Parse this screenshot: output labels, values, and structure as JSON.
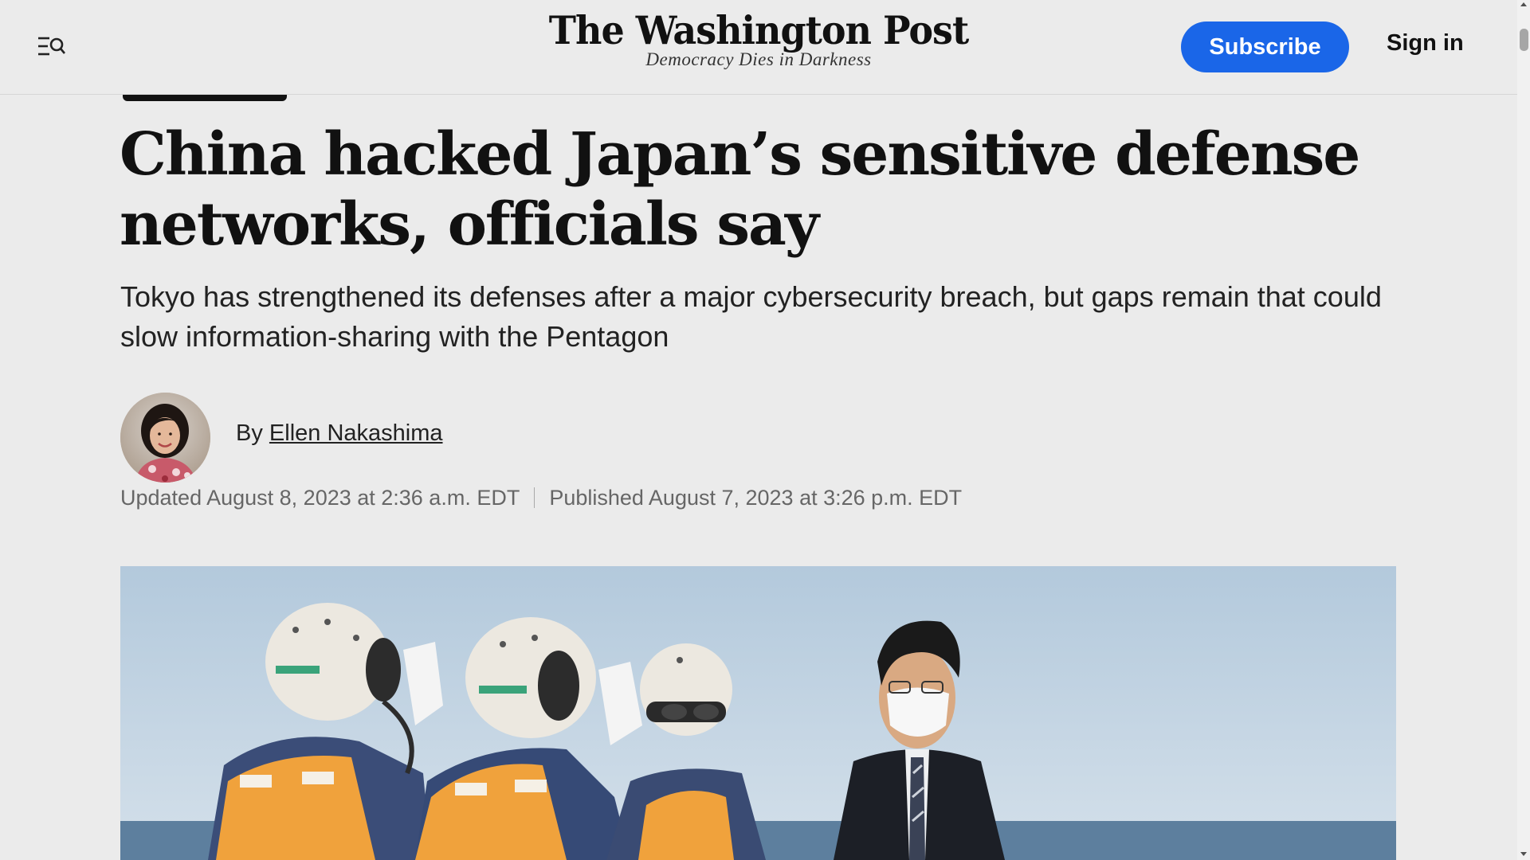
{
  "header": {
    "logo": "The Washington Post",
    "tagline": "Democracy Dies in Darkness",
    "subscribe_label": "Subscribe",
    "signin_label": "Sign in"
  },
  "article": {
    "headline": "China hacked Japan’s sensitive defense networks, officials say",
    "dek": "Tokyo has strengthened its defenses after a major cybersecurity breach, but gaps remain that could slow information-sharing with the Pentagon",
    "byline_prefix": "By",
    "author": "Ellen Nakashima",
    "updated": "Updated August 8, 2023 at 2:36 a.m. EDT",
    "published": "Published August 7, 2023 at 3:26 p.m. EDT"
  },
  "colors": {
    "accent": "#1a66e8",
    "background": "#ebebeb"
  }
}
